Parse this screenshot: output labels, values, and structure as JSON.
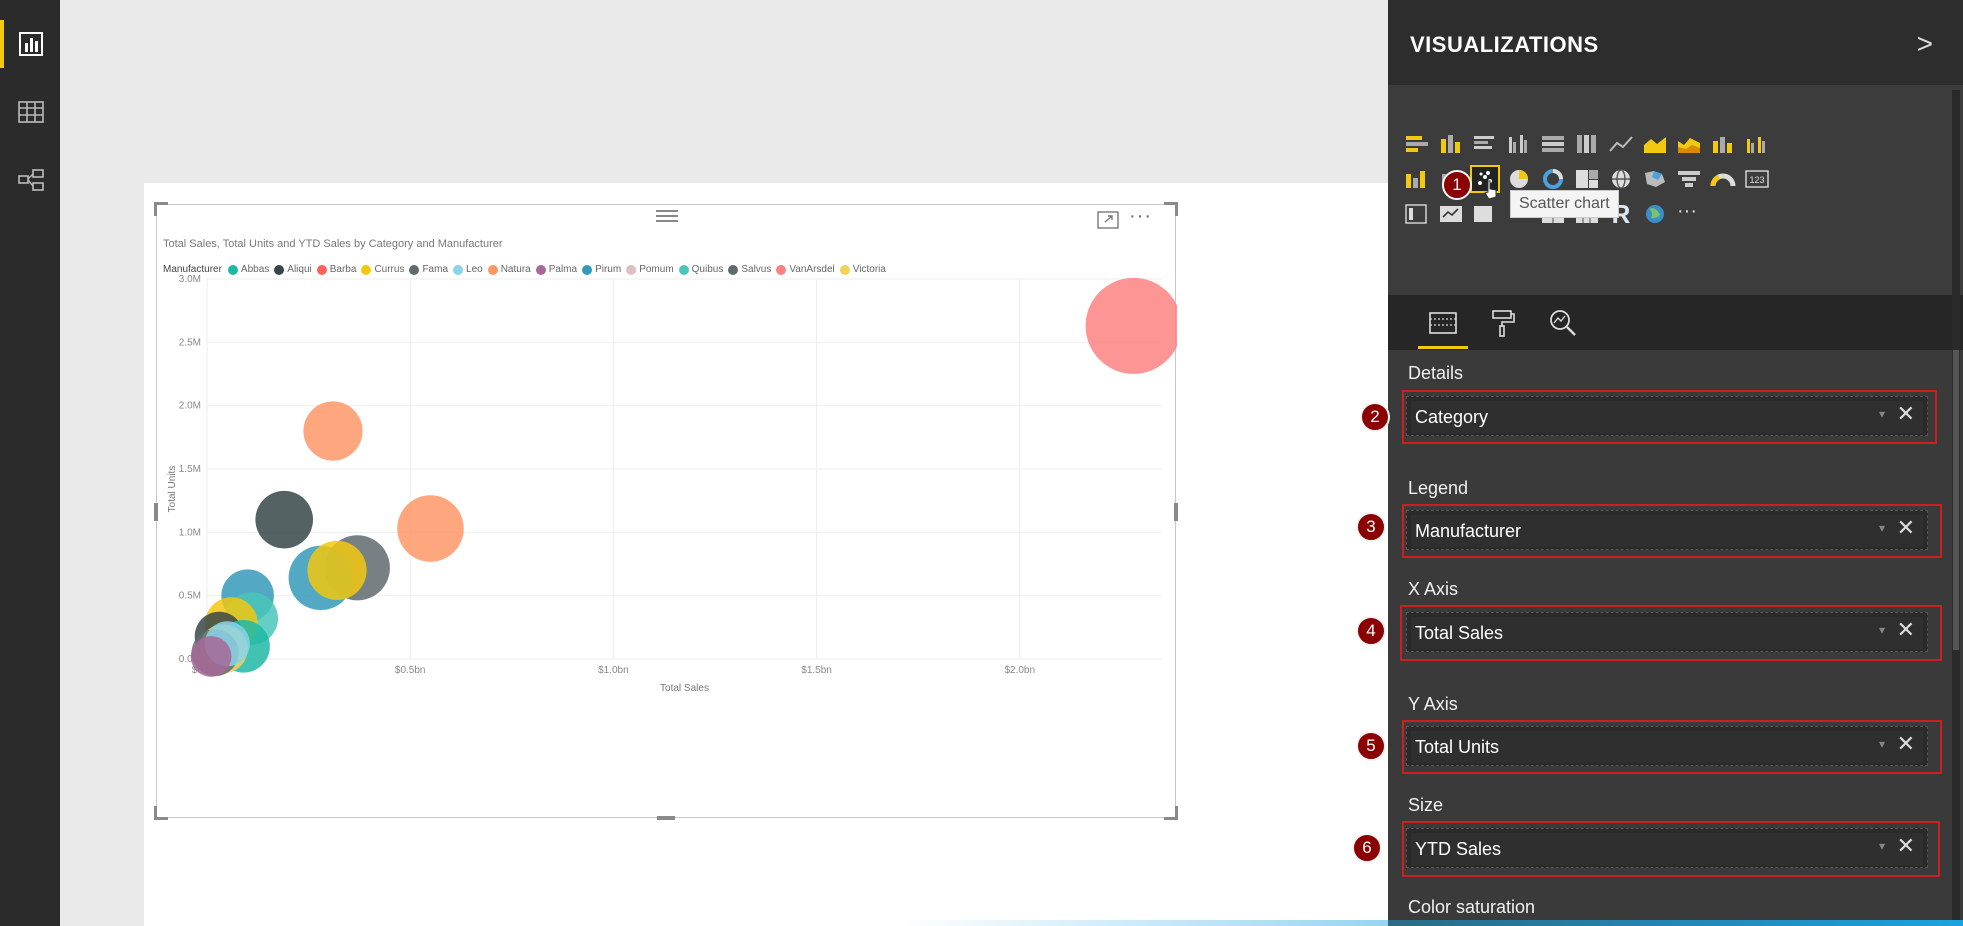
{
  "nav": {
    "items": [
      {
        "name": "report-view",
        "icon": "bar-chart-icon",
        "active": true
      },
      {
        "name": "data-view",
        "icon": "table-grid-icon",
        "active": false
      },
      {
        "name": "relationships-view",
        "icon": "relationships-icon",
        "active": false
      }
    ]
  },
  "visual": {
    "title": "Total Sales, Total Units and YTD Sales by Category and Manufacturer",
    "legend_title": "Manufacturer",
    "legend": [
      {
        "name": "Abbas",
        "color": "#1fb8a6"
      },
      {
        "name": "Aliqui",
        "color": "#374649"
      },
      {
        "name": "Barba",
        "color": "#fd625e"
      },
      {
        "name": "Currus",
        "color": "#f2c80f"
      },
      {
        "name": "Fama",
        "color": "#5f6b6d"
      },
      {
        "name": "Leo",
        "color": "#8ad4eb"
      },
      {
        "name": "Natura",
        "color": "#fe9666"
      },
      {
        "name": "Palma",
        "color": "#a66999"
      },
      {
        "name": "Pirum",
        "color": "#3599b8"
      },
      {
        "name": "Pomum",
        "color": "#dfbfbf"
      },
      {
        "name": "Quibus",
        "color": "#4ac5bb"
      },
      {
        "name": "Salvus",
        "color": "#5f6b6d"
      },
      {
        "name": "VanArsdel",
        "color": "#fb8281"
      },
      {
        "name": "Victoria",
        "color": "#f4d25a"
      }
    ]
  },
  "chart_data": {
    "type": "scatter",
    "title": "Total Sales, Total Units and YTD Sales by Category and Manufacturer",
    "xlabel": "Total Sales",
    "ylabel": "Total Units",
    "xlim": [
      0,
      2.35
    ],
    "ylim": [
      0,
      3.0
    ],
    "x_unit": "$bn",
    "y_unit": "M",
    "xticks": [
      "$0.0bn",
      "$0.5bn",
      "$1.0bn",
      "$1.5bn",
      "$2.0bn"
    ],
    "xtick_values": [
      0,
      0.5,
      1.0,
      1.5,
      2.0
    ],
    "yticks": [
      "0.0M",
      "0.5M",
      "1.0M",
      "1.5M",
      "2.0M",
      "2.5M",
      "3.0M"
    ],
    "ytick_values": [
      0,
      0.5,
      1.0,
      1.5,
      2.0,
      2.5,
      3.0
    ],
    "grid": true,
    "legend_position": "top-left",
    "points": [
      {
        "series": "VanArsdel",
        "x": 2.28,
        "y": 2.63,
        "size": 1.0,
        "color": "#fb8281"
      },
      {
        "series": "Natura",
        "x": 0.31,
        "y": 1.8,
        "size": 0.38,
        "color": "#fe9666"
      },
      {
        "series": "Natura",
        "x": 0.55,
        "y": 1.03,
        "size": 0.48,
        "color": "#fe9666"
      },
      {
        "series": "Aliqui",
        "x": 0.19,
        "y": 1.1,
        "size": 0.36,
        "color": "#374649"
      },
      {
        "series": "Fama",
        "x": 0.37,
        "y": 0.72,
        "size": 0.46,
        "color": "#5f6b6d"
      },
      {
        "series": "Pirum",
        "x": 0.28,
        "y": 0.64,
        "size": 0.45,
        "color": "#3599b8"
      },
      {
        "series": "Currus",
        "x": 0.32,
        "y": 0.7,
        "size": 0.38,
        "color": "#f2c80f"
      },
      {
        "series": "Pirum",
        "x": 0.1,
        "y": 0.5,
        "size": 0.3,
        "color": "#3599b8"
      },
      {
        "series": "Quibus",
        "x": 0.11,
        "y": 0.32,
        "size": 0.3,
        "color": "#4ac5bb"
      },
      {
        "series": "Currus",
        "x": 0.06,
        "y": 0.28,
        "size": 0.3,
        "color": "#f2c80f"
      },
      {
        "series": "Aliqui",
        "x": 0.03,
        "y": 0.18,
        "size": 0.26,
        "color": "#374649"
      },
      {
        "series": "Abbas",
        "x": 0.09,
        "y": 0.1,
        "size": 0.3,
        "color": "#1fb8a6"
      },
      {
        "series": "Victoria",
        "x": 0.04,
        "y": 0.08,
        "size": 0.26,
        "color": "#f4d25a"
      },
      {
        "series": "Salvus",
        "x": 0.02,
        "y": 0.05,
        "size": 0.24,
        "color": "#5f6b6d"
      },
      {
        "series": "Leo",
        "x": 0.05,
        "y": 0.12,
        "size": 0.22,
        "color": "#8ad4eb"
      },
      {
        "series": "Palma",
        "x": 0.01,
        "y": 0.02,
        "size": 0.18,
        "color": "#a66999"
      }
    ]
  },
  "vizpane": {
    "title": "VISUALIZATIONS",
    "collapse_glyph": ">",
    "tooltip": "Scatter chart",
    "more_glyph": "···",
    "wells": [
      {
        "label": "Details",
        "field": "Category",
        "step": "2"
      },
      {
        "label": "Legend",
        "field": "Manufacturer",
        "step": "3"
      },
      {
        "label": "X Axis",
        "field": "Total Sales",
        "step": "4"
      },
      {
        "label": "Y Axis",
        "field": "Total Units",
        "step": "5"
      },
      {
        "label": "Size",
        "field": "YTD Sales",
        "step": "6"
      },
      {
        "label": "Color saturation"
      }
    ],
    "step1": "1",
    "remove_glyph": "✕",
    "dropdown_glyph": "▾"
  }
}
